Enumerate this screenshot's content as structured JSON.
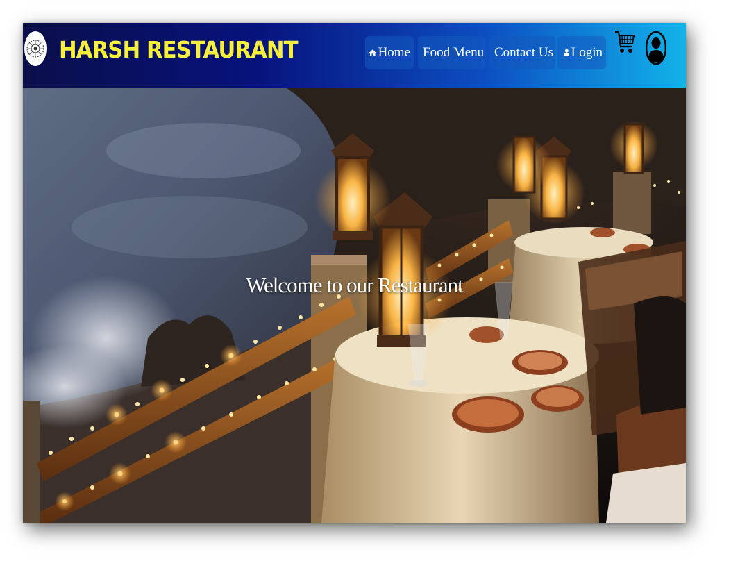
{
  "brand": {
    "name": "HARSH RESTAURANT",
    "logo_icon": "circular-emblem-logo",
    "color": "#f7ef3a"
  },
  "nav": {
    "items": [
      {
        "label": "Home",
        "icon": "home-icon"
      },
      {
        "label": "Food Menu",
        "icon": "fork-knife-icon"
      },
      {
        "label": "Contact Us",
        "icon": "pencil-icon"
      },
      {
        "label": "Login",
        "icon": "user-icon"
      }
    ],
    "cart_icon": "shopping-cart-icon",
    "profile_icon": "user-circle-icon"
  },
  "hero": {
    "welcome_text": "Welcome to our Restaurant",
    "image": "seaside-restaurant-tables-with-lanterns-at-night"
  },
  "colors": {
    "navbar_start": "#0a0f4a",
    "navbar_mid": "#07127c",
    "navbar_end": "#12b3ea",
    "nav_button_bg": "#1e5cc0",
    "brand_text": "#f7ef3a"
  }
}
